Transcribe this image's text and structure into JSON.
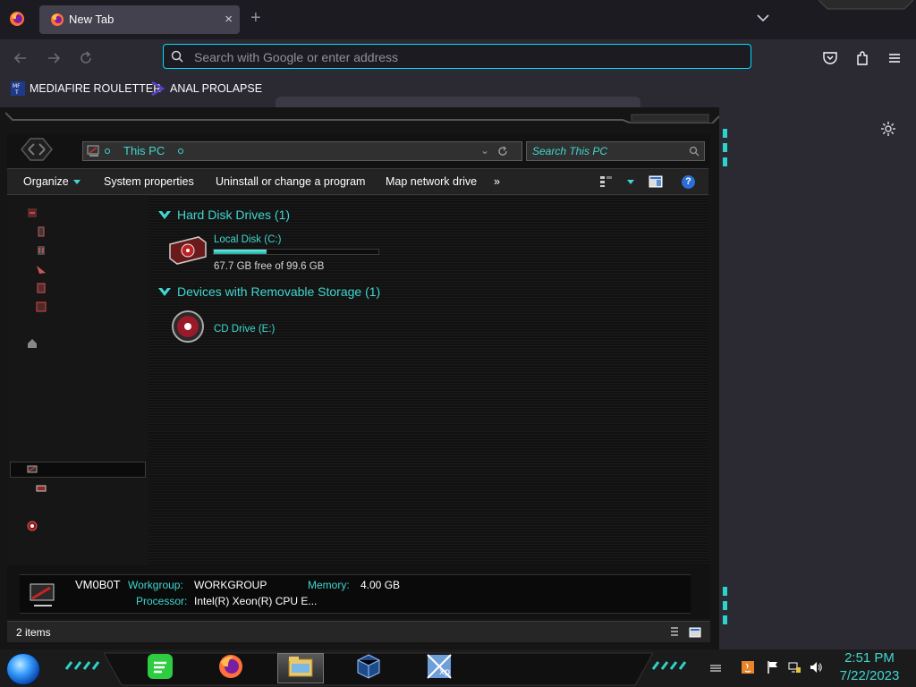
{
  "browser": {
    "tab_title": "New Tab",
    "new_tab_symbol": "+",
    "close_symbol": "×",
    "url_placeholder": "Search with Google or enter address",
    "bookmarks": [
      {
        "label": "MEDIAFIRE ROULETTER",
        "icon": "mediafire-favicon"
      },
      {
        "label": "ANAL PROLAPSE",
        "icon": "purple-chevron-favicon"
      }
    ],
    "accent_color": "#00ddff"
  },
  "explorer": {
    "breadcrumb": "This PC",
    "search_placeholder": "Search This PC",
    "toolbar": {
      "organize": "Organize",
      "system_properties": "System properties",
      "uninstall": "Uninstall or change a program",
      "map_drive": "Map network drive",
      "more": "»"
    },
    "groups": [
      {
        "header": "Hard Disk Drives (1)",
        "items": [
          {
            "name": "Local Disk (C:)",
            "free_text": "67.7 GB free of 99.6 GB",
            "used_fraction": 0.32
          }
        ]
      },
      {
        "header": "Devices with Removable Storage (1)",
        "items": [
          {
            "name": "CD Drive (E:)"
          }
        ]
      }
    ],
    "details": {
      "computer_name": "VM0B0T",
      "workgroup_label": "Workgroup:",
      "workgroup_value": "WORKGROUP",
      "memory_label": "Memory:",
      "memory_value": "4.00 GB",
      "processor_label": "Processor:",
      "processor_value": "Intel(R) Xeon(R) CPU E..."
    },
    "status": "2 items",
    "accent_color": "#3fd7cf"
  },
  "taskbar": {
    "apps": [
      "spotify-icon",
      "firefox-icon",
      "file-explorer-icon",
      "virtualbox-icon",
      "windows-xp-icon"
    ],
    "time": "2:51 PM",
    "date": "7/22/2023"
  }
}
